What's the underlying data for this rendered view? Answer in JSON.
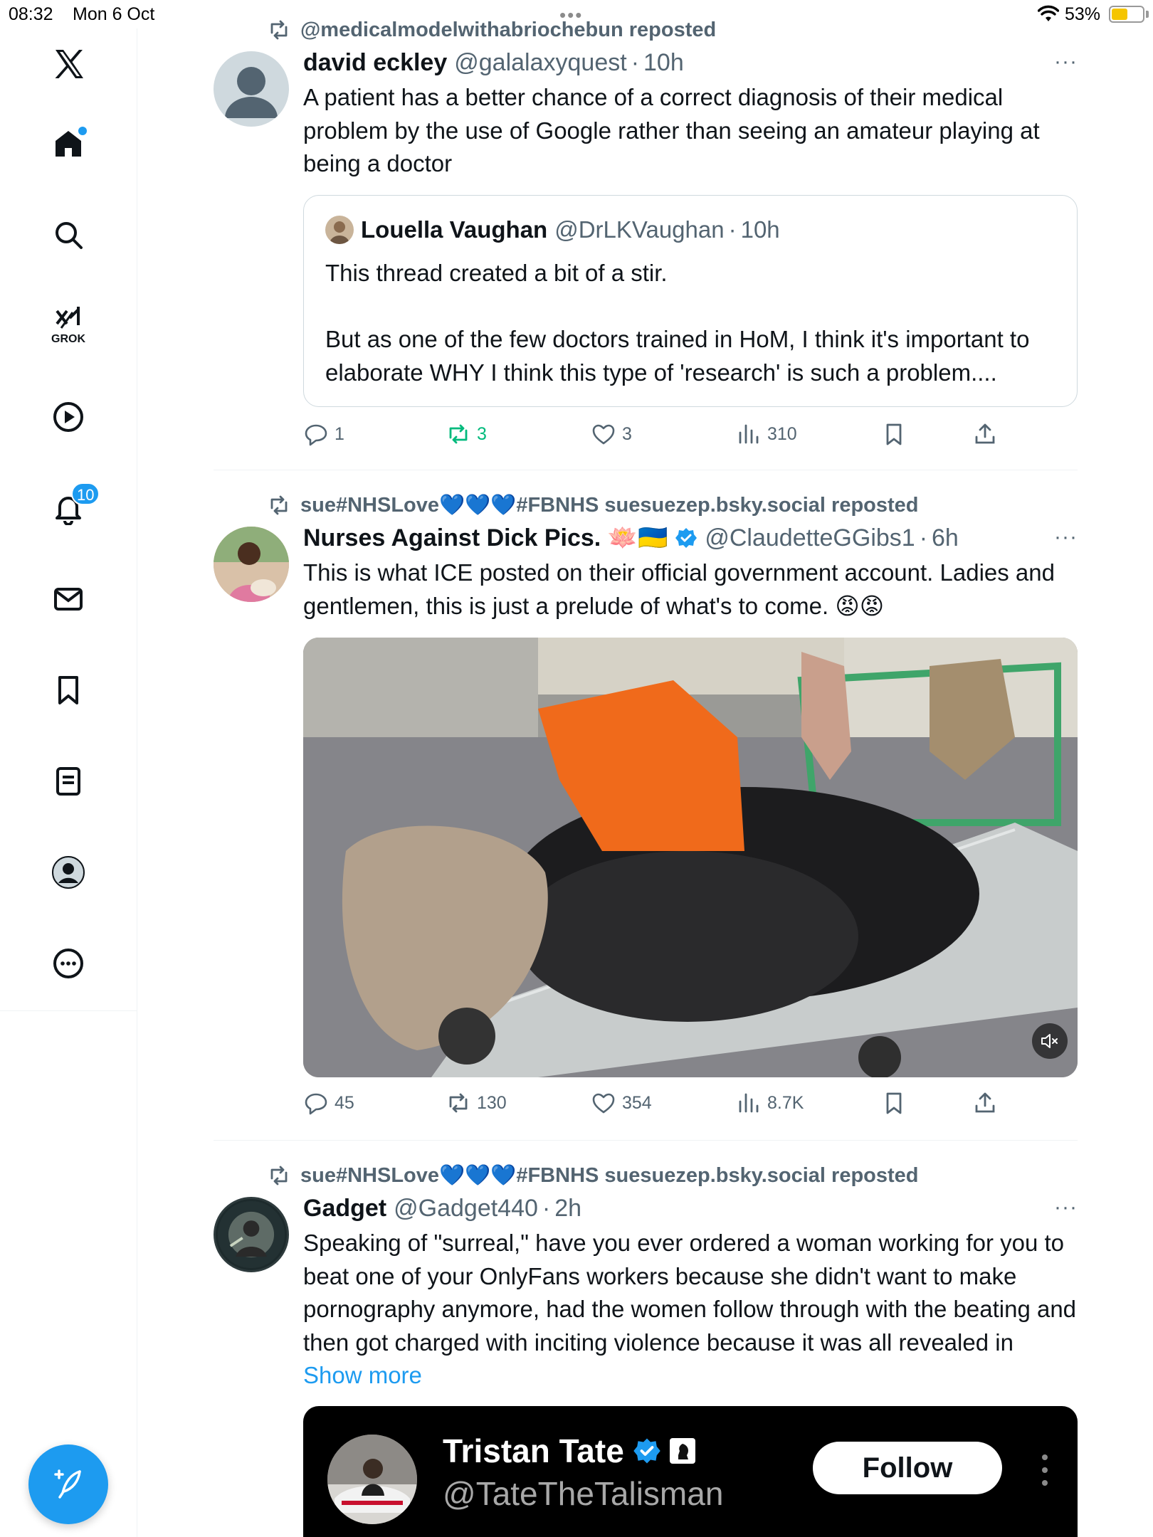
{
  "status_bar": {
    "time": "08:32",
    "date": "Mon 6 Oct",
    "battery_pct": "53%",
    "battery_level": 0.53,
    "multitask_dots": "•••"
  },
  "sidebar": {
    "items": [
      {
        "id": "logo",
        "icon": "x-logo-icon"
      },
      {
        "id": "home",
        "icon": "home-icon",
        "has_dot": true
      },
      {
        "id": "explore",
        "icon": "search-icon"
      },
      {
        "id": "grok",
        "icon": "grok-icon",
        "label": "GROK"
      },
      {
        "id": "video",
        "icon": "play-icon"
      },
      {
        "id": "notifications",
        "icon": "bell-icon",
        "badge": "10"
      },
      {
        "id": "messages",
        "icon": "mail-icon"
      },
      {
        "id": "bookmarks",
        "icon": "bookmark-icon"
      },
      {
        "id": "lists",
        "icon": "list-icon"
      },
      {
        "id": "profile",
        "icon": "avatar-icon"
      },
      {
        "id": "more",
        "icon": "more-circle-icon"
      }
    ],
    "compose_icon": "compose-icon"
  },
  "accent_color": "#1d9bf0",
  "posts": [
    {
      "repost_by": "@medicalmodelwithabriochebun reposted",
      "name": "david eckley",
      "handle": "@galalaxyquest",
      "sep": "·",
      "time": "10h",
      "text": "A patient has a better chance of a correct diagnosis of their medical problem by the use of Google rather than seeing an amateur playing at being a doctor",
      "quote": {
        "name": "Louella Vaughan",
        "handle": "@DrLKVaughan",
        "time": "10h",
        "text_1": "This thread created a bit of a stir.",
        "text_2": "But as one of the few doctors trained in HoM, I think it's important to elaborate WHY I think this type of 'research' is such a problem...."
      },
      "stats": {
        "replies": "1",
        "reposts": "3",
        "likes": "3",
        "views": "310"
      }
    },
    {
      "repost_by": "sue#NHSLove💙💙💙#FBNHS suesuezep.bsky.social reposted",
      "name": "Nurses Against Dick Pics. 🪷🇺🇦",
      "handle": "@ClaudetteGGibs1",
      "sep": "·",
      "time": "6h",
      "text": "This is what ICE posted on their official government account. Ladies and gentlemen, this is just a prelude of what's to come. 😡😡",
      "stats": {
        "replies": "45",
        "reposts": "130",
        "likes": "354",
        "views": "8.7K"
      }
    },
    {
      "repost_by": "sue#NHSLove💙💙💙#FBNHS suesuezep.bsky.social reposted",
      "name": "Gadget",
      "handle": "@Gadget440",
      "sep": "·",
      "time": "2h",
      "text": "Speaking of \"surreal,\" have you ever ordered a woman working for you to beat one of your OnlyFans workers because she didn't want to make pornography anymore, had the women follow through with the beating and then got charged with inciting violence because it was all revealed in ",
      "show_more": "Show more",
      "embed": {
        "name": "Tristan Tate",
        "handle": "@TateTheTalisman",
        "follow": "Follow"
      }
    }
  ],
  "more_glyph": "···"
}
